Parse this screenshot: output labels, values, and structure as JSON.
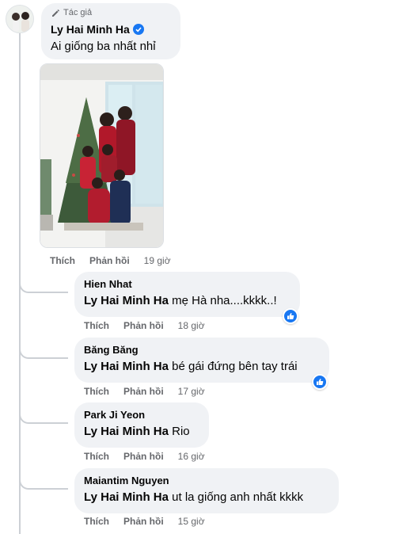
{
  "main_comment": {
    "author_badge": "Tác giả",
    "author": "Ly Hai Minh Ha",
    "text": "Ai giống ba nhất nhỉ",
    "actions": {
      "like": "Thích",
      "reply": "Phản hồi",
      "time": "19 giờ"
    }
  },
  "replies": [
    {
      "author": "Hien Nhat",
      "mention": "Ly Hai Minh Ha",
      "text": "mẹ Hà nha....kkkk..!",
      "like": "Thích",
      "reply": "Phản hồi",
      "time": "18 giờ",
      "has_reaction": true
    },
    {
      "author": "Băng Băng",
      "mention": "Ly Hai Minh Ha",
      "text": "bé gái đứng bên tay trái",
      "like": "Thích",
      "reply": "Phản hồi",
      "time": "17 giờ",
      "has_reaction": true
    },
    {
      "author": "Park Ji Yeon",
      "mention": "Ly Hai Minh Ha",
      "text": "Rio",
      "like": "Thích",
      "reply": "Phản hồi",
      "time": "16 giờ",
      "has_reaction": false
    },
    {
      "author": "Maiantim Nguyen",
      "mention": "Ly Hai Minh Ha",
      "text": "ut la giống anh nhất kkkk",
      "like": "Thích",
      "reply": "Phản hồi",
      "time": "15 giờ",
      "has_reaction": false
    }
  ],
  "colors": {
    "bubble": "#f0f2f5",
    "meta": "#65676b",
    "accent": "#1877f2",
    "thread_line": "#ccd0d5"
  },
  "icons": {
    "badge": "pencil-icon",
    "verified": "verified-check-icon",
    "reaction": "like-icon"
  }
}
